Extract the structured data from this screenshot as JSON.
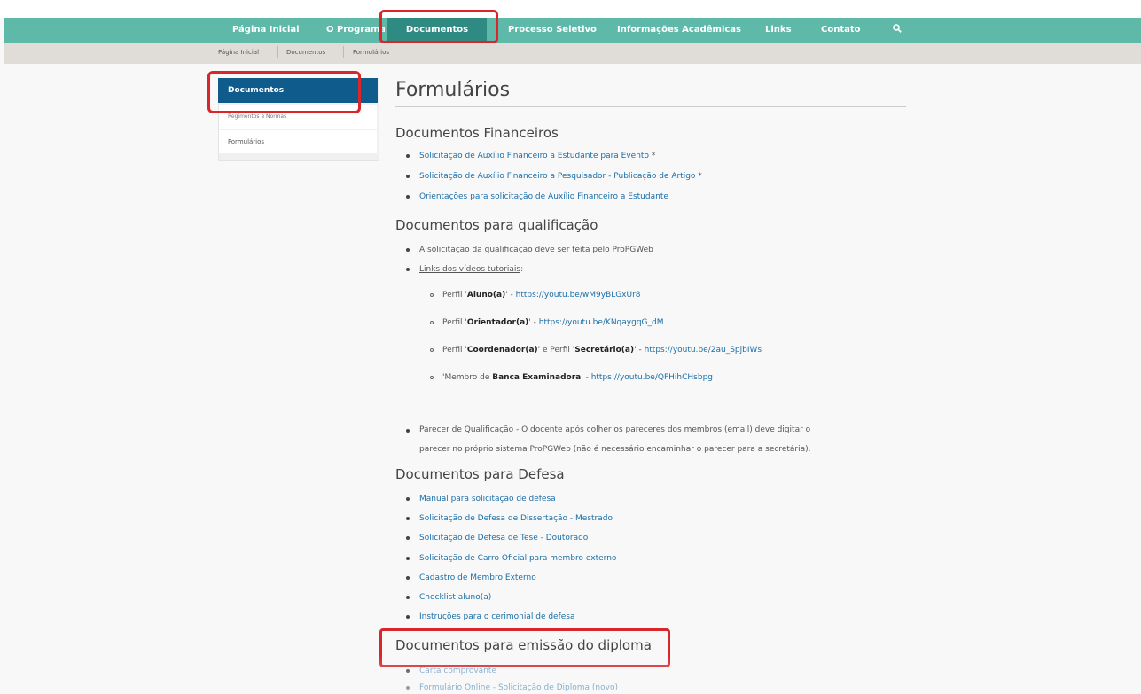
{
  "nav": {
    "items": [
      "Página Inicial",
      "O Programa",
      "Documentos",
      "Processo Seletivo",
      "Informações Acadêmicas",
      "Links",
      "Contato"
    ],
    "active": "Documentos"
  },
  "breadcrumb": [
    "Página Inicial",
    "Documentos",
    "Formulários"
  ],
  "sidebar": {
    "items": [
      "Documentos",
      "Regimentos e Normas",
      "Formulários"
    ]
  },
  "main": {
    "title": "Formulários",
    "financeiros": {
      "heading": "Documentos Financeiros",
      "links": [
        "Solicitação de Auxílio Financeiro a Estudante para Evento",
        "Solicitação de Auxílio Financeiro a Pesquisador - Publicação de Artigo",
        "Orientações para solicitação de Auxílio Financeiro a Estudante"
      ],
      "asterisk": "*"
    },
    "qualificacao": {
      "heading": "Documentos para qualificação",
      "item1": "A solicitação da qualificação deve ser feita pelo ProPGWeb",
      "item2": "Links dos vídeos tutoriais",
      "item2_colon": ":",
      "videos": [
        {
          "pre": "Perfil '",
          "bold": "Aluno(a)",
          "post": "' - ",
          "bold2": "",
          "post2": "",
          "url": "https://youtu.be/wM9yBLGxUr8"
        },
        {
          "pre": "Perfil '",
          "bold": "Orientador(a)",
          "post": "' - ",
          "bold2": "",
          "post2": "",
          "url": "https://youtu.be/KNqaygqG_dM"
        },
        {
          "pre": "Perfil '",
          "bold": "Coordenador(a)",
          "post": "' e Perfil '",
          "bold2": "Secretário(a)",
          "post2": "' - ",
          "url": "https://youtu.be/2au_SpjbIWs"
        },
        {
          "pre": "'Membro de ",
          "bold": "Banca Examinadora",
          "post": "' - ",
          "bold2": "",
          "post2": "",
          "url": "https://youtu.be/QFHihCHsbpg"
        }
      ],
      "parecer_line1": "Parecer de Qualificação - O docente após colher os pareceres dos membros (email) deve digitar o",
      "parecer_line2": "parecer no próprio sistema ProPGWeb (não é necessário encaminhar o parecer para a secretária)."
    },
    "defesa": {
      "heading": "Documentos para Defesa",
      "links": [
        "Manual para solicitação de defesa",
        "Solicitação de Defesa de Dissertação - Mestrado",
        "Solicitação de Defesa de Tese - Doutorado",
        "Solicitação de Carro Oficial para membro externo",
        "Cadastro de Membro Externo",
        "Checklist aluno(a)",
        "Instruções para o cerimonial de defesa"
      ]
    },
    "diploma": {
      "heading": "Documentos para emissão do diploma",
      "links": [
        "Carta comprovante",
        "Formulário Online - Solicitação de Diploma (novo)"
      ]
    }
  },
  "colors": {
    "nav_bg": "#5fb9a9",
    "nav_active": "#2f8a82",
    "sidebar_active": "#0e5b8c",
    "link": "#1a6ea8",
    "highlight": "#d9262b"
  }
}
